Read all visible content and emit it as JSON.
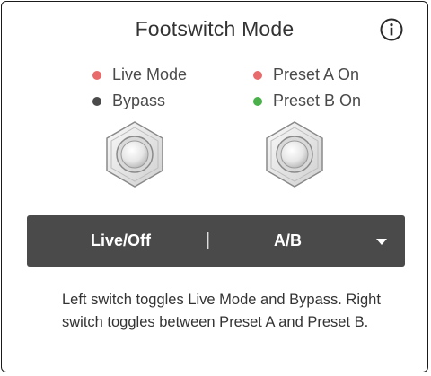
{
  "header": {
    "title": "Footswitch Mode",
    "info_icon": "info-icon"
  },
  "legend": {
    "left": [
      {
        "label": "Live Mode",
        "color": "#e86a6a"
      },
      {
        "label": "Bypass",
        "color": "#4a4a4a"
      }
    ],
    "right": [
      {
        "label": "Preset A On",
        "color": "#e86a6a"
      },
      {
        "label": "Preset B On",
        "color": "#4ab04a"
      }
    ]
  },
  "switches": {
    "left_icon": "footswitch-icon",
    "right_icon": "footswitch-icon"
  },
  "mode_selector": {
    "left_label": "Live/Off",
    "divider": "|",
    "right_label": "A/B",
    "caret_icon": "caret-down-icon",
    "background": "#4a4a4a"
  },
  "description": "Left switch toggles Live Mode and Bypass. Right switch toggles between Preset A and Preset B."
}
